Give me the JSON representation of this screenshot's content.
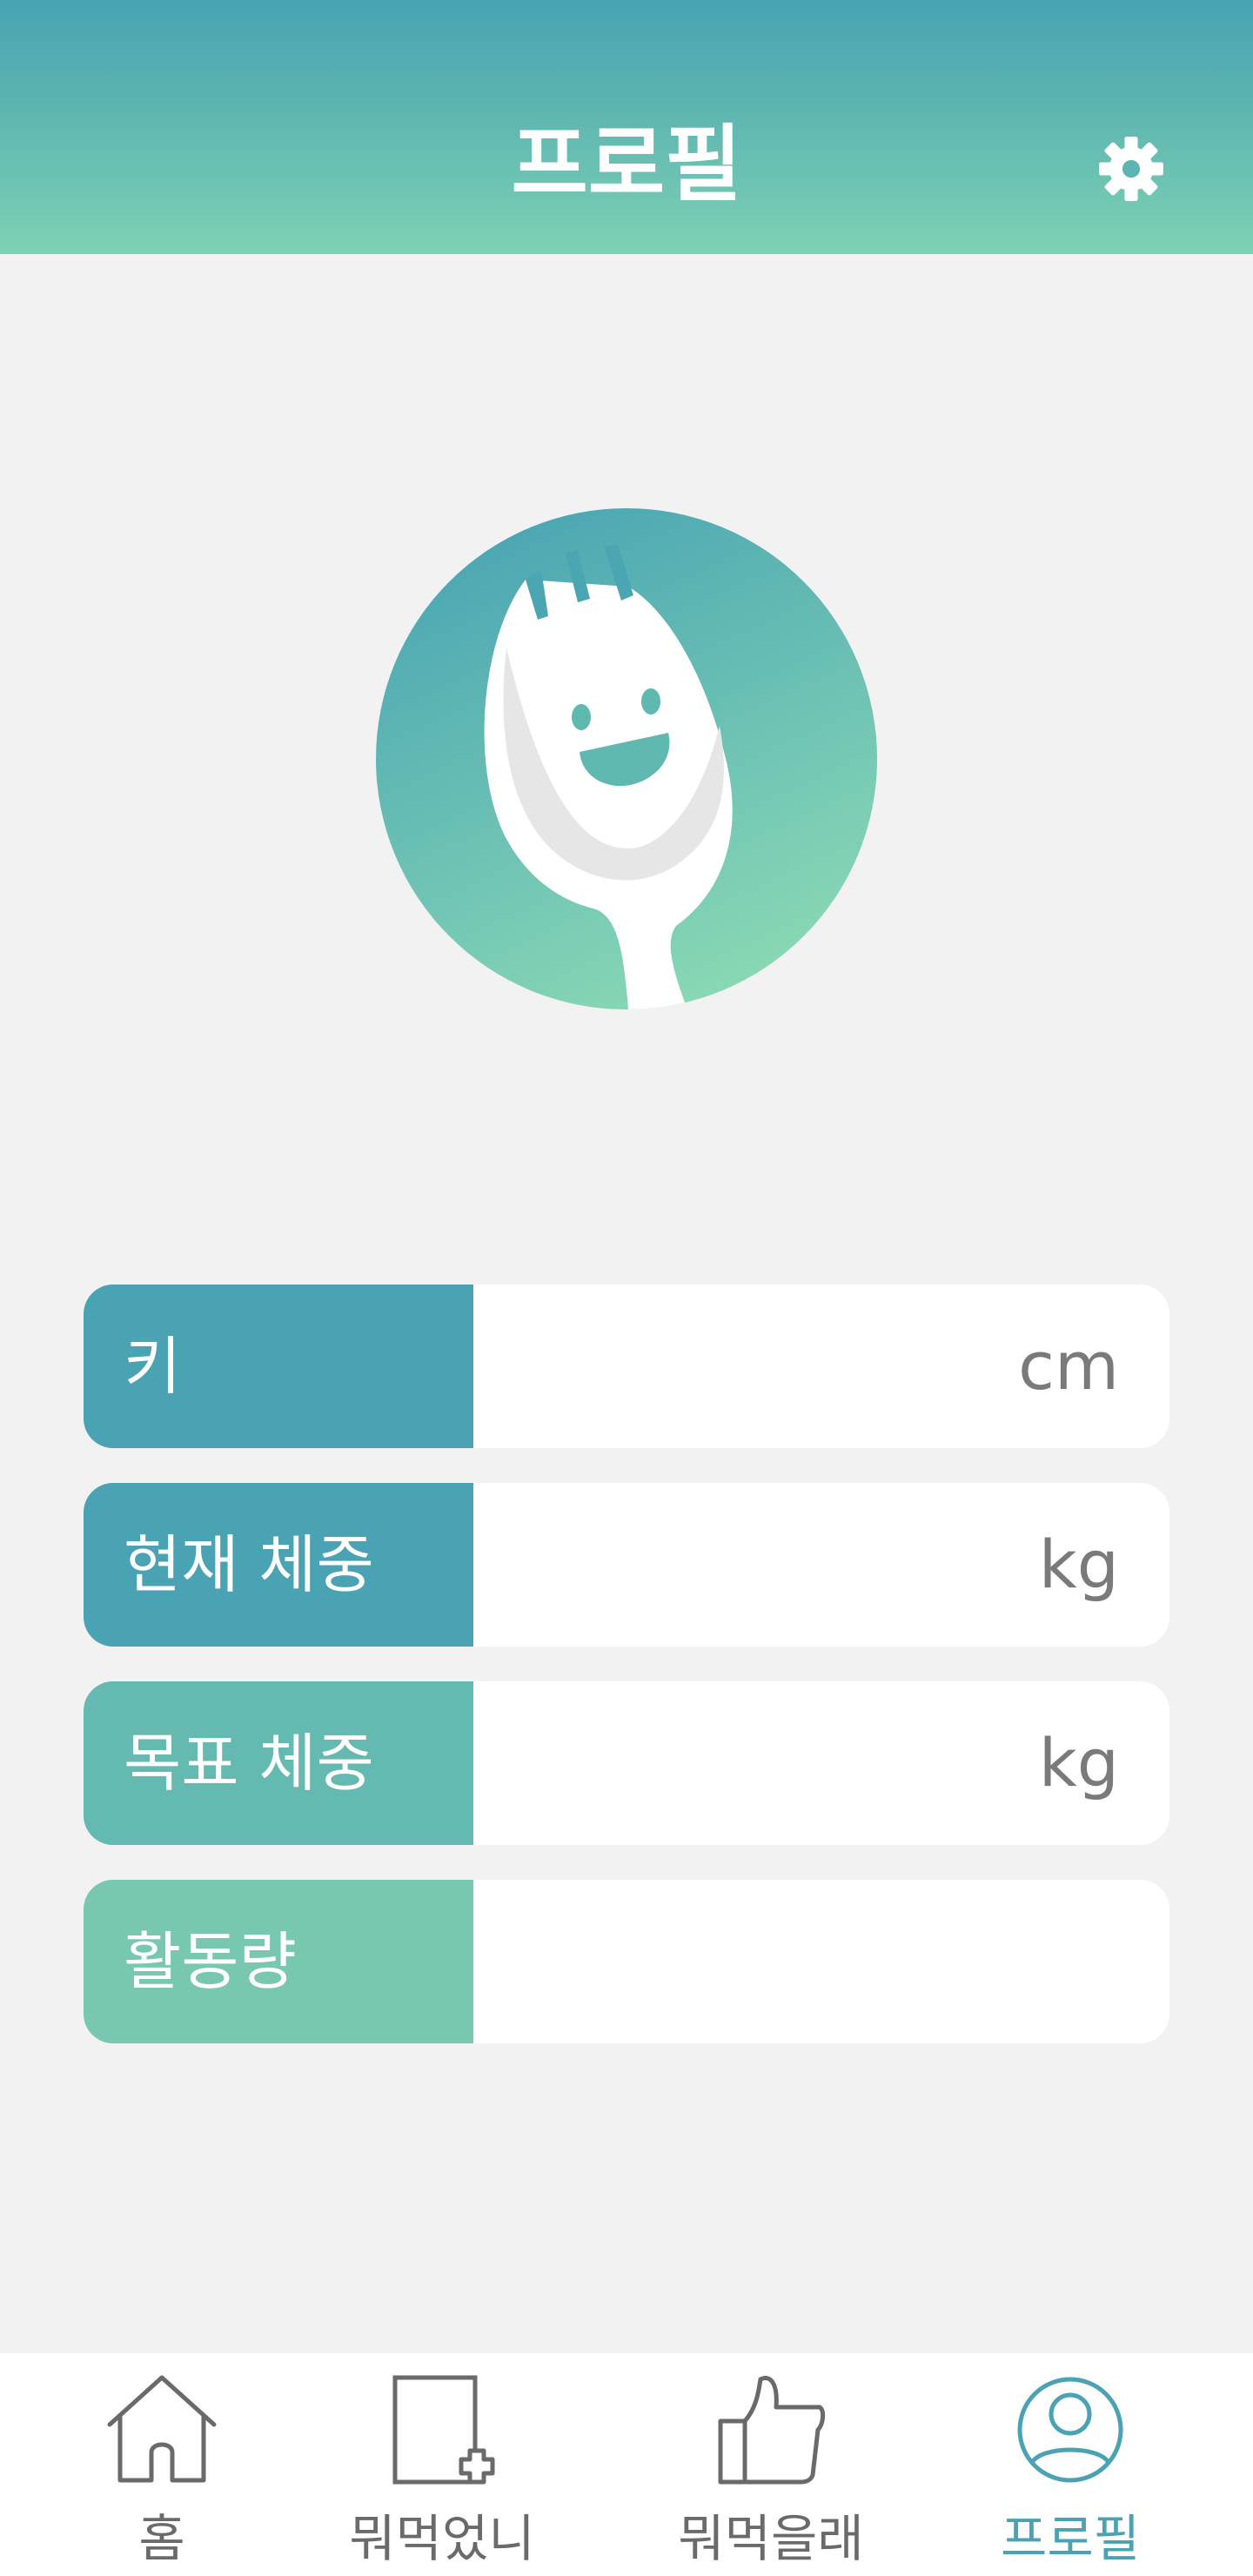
{
  "header": {
    "title": "프로필",
    "settings_icon": "gear-icon"
  },
  "avatar": {
    "icon": "spoon-mascot-icon"
  },
  "fields": [
    {
      "label": "키",
      "value": "",
      "unit": "cm",
      "color": "#4aa3b3"
    },
    {
      "label": "현재 체중",
      "value": "",
      "unit": "kg",
      "color": "#4aa3b3"
    },
    {
      "label": "목표 체중",
      "value": "",
      "unit": "kg",
      "color": "#64b9b0"
    },
    {
      "label": "활동량",
      "value": "",
      "unit": "",
      "color": "#78c8b1"
    }
  ],
  "nav": {
    "items": [
      {
        "label": "홈",
        "icon": "home-icon",
        "active": false
      },
      {
        "label": "뭐먹었니",
        "icon": "add-note-icon",
        "active": false
      },
      {
        "label": "뭐먹을래",
        "icon": "thumbs-up-icon",
        "active": false
      },
      {
        "label": "프로필",
        "icon": "profile-icon",
        "active": true
      }
    ]
  },
  "colors": {
    "accent": "#4aa2b2",
    "mint": "#7dd2b4",
    "background": "#f2f2f2",
    "inactive": "#6a6a6a"
  }
}
